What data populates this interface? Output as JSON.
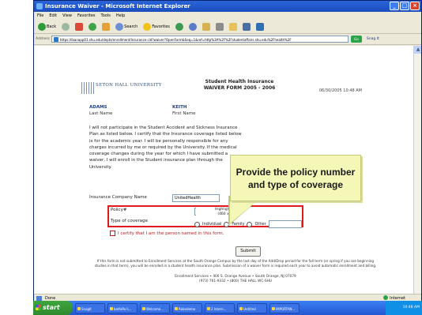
{
  "window": {
    "title": "Insurance Waiver - Microsoft Internet Explorer",
    "buttons": {
      "minimize": "_",
      "maximize": "□",
      "close": "×"
    }
  },
  "menu": {
    "items": [
      "File",
      "Edit",
      "View",
      "Favorites",
      "Tools",
      "Help"
    ]
  },
  "toolbar": {
    "back": "Back",
    "search": "Search",
    "favorites": "Favorites"
  },
  "address": {
    "label": "Address",
    "url": "https://ibanapp01.shu.edu/depts/enrollment/insurance.cid?waiver?OpenForm&Seq=1&ref=http%3A%2F%2Fstudentaffairs.shu.edu%2Fhealth%2F",
    "go": "Go",
    "links": "Snag It"
  },
  "form": {
    "logo_text": "SETON HALL UNIVERSITY",
    "title_line1": "Student Health Insurance",
    "title_line2": "WAIVER FORM 2005 - 2006",
    "date": "06/30/2005 10:48 AM",
    "last_name_value": "ADAMS",
    "last_name_label": "Last Name",
    "first_name_value": "KEITH",
    "first_name_label": "First Name",
    "paragraph": "I will not participate in the Student Accident and Sickness Insurance Plan as listed below. I certify that the Insurance coverage listed below is for the academic year. I will be personally responsible for any charges incurred by me or required by the University. If the medical coverage changes during the year for which I have submitted a waiver, I will enroll in the Student insurance plan through the University.",
    "insurance_company_label": "Insurance Company Name",
    "insurance_company_value": "UnitedHealth",
    "policy_label": "Policy#",
    "coverage_label": "Type of coverage",
    "highlight_caption_line1": "Highlight Box",
    "highlight_caption_line2": "(460 x 54)",
    "radio_options": [
      "Individual",
      "Family",
      "Other"
    ],
    "certify_label": "I certify that I am the person named in this form.",
    "submit": "Submit",
    "footer_note": "If this form is not submitted to Enrollment Services at the South Orange Campus by the last day of the Add/Drop period for the fall term (or spring if you are beginning studies in that term), you will be enrolled in a student health insurance plan. Submission of a waiver form is required each year to avoid automatic enrollment and billing.",
    "footer_address_line1": "Enrollment Services • 400 S. Orange Avenue • South Orange, NJ 07079",
    "footer_address_line2": "(973) 761-9332 • (800) THE HALL WC-SHU"
  },
  "callout": {
    "text": "Provide the policy number and type of coverage"
  },
  "status": {
    "left": "Done",
    "zone": "Internet"
  },
  "taskbar": {
    "start": "start",
    "items": [
      "SnagIt",
      "batfaflu's...",
      "Welcome...",
      "Robodemo",
      "2 Intern...",
      "Untitled",
      "IMPORTAN..."
    ],
    "clock": "10:48 AM"
  }
}
